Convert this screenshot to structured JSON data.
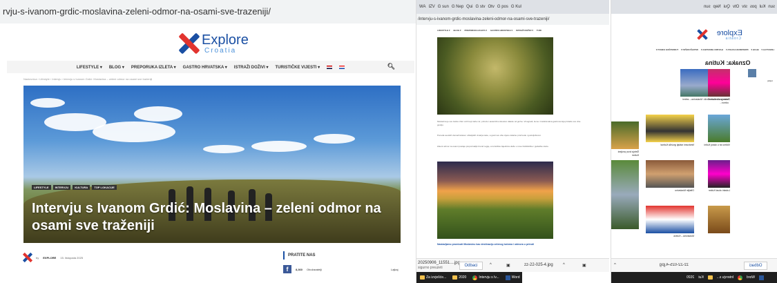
{
  "panel1": {
    "url": "rvju-s-ivanom-grdic-moslavina-zeleni-odmor-na-osami-sve-trazeniji/",
    "logo": {
      "word1": "Explore",
      "word2": "Croatia"
    },
    "nav": [
      "LIFESTYLE ▾",
      "BLOG ▾",
      "PREPORUKA IZLETA ▾",
      "GASTRO HRVATSKA ▾",
      "ISTRAŽI DOŽIVI ▾",
      "TURISTIČKE VIJESTI ▾"
    ],
    "breadcrumb": "Naslovnica › Lifestyle › Intervju › Intervju s Ivanom Grdić: Moslavina – zeleni odmor na osami sve traženiji",
    "tags": [
      "LIFESTYLE",
      "INTERVJU",
      "KULTURA",
      "TOP LOKACIJE"
    ],
    "title": "Intervju s Ivanom Grdić: Moslavina – zeleni odmor na osami sve traženiji",
    "author_by": "by",
    "author": "EXPLORE",
    "date": "15. listopada 2025",
    "follow": "PRATITE NAS",
    "fb_count": "8,360",
    "fb_label": "Obožavatelji",
    "likes": "Lajkaj"
  },
  "panel2": {
    "tabs": [
      "WA",
      "IZV",
      "G sun",
      "G Nep",
      "Qui",
      "G stv",
      "Otv",
      "G pos",
      "G Kul"
    ],
    "url": "/intervju-s-ivanom-grdic-moslavina-zeleni-odmor-na-osami-sve-trazeniji/",
    "nav": [
      "LIFESTYLE ▾",
      "BLOG ▾",
      "PREPORUKA IZLETA ▾",
      "GASTRO HRVATSKA ▾",
      "ISTRAŽI DOŽIVI ▾",
      "TURI"
    ],
    "para1": "Moslavina je sve češće izbor onih koji traže mir, prirodu i autentično iskustvo daleko od gužve. Vinogradi, šume i tradicionalna gastronomija privlače sve više gostiju.",
    "para2": "Ponuda seoskih domaćinstava i obiteljskih vinarija raste, a gosti sve više cijene lokalne proizvode i gostoljubivost.",
    "para3": "Zeleni odmor na osami postaje prepoznatljiv brend regije, a turistička zajednica ulaže u nove biciklističke i pješačke staze.",
    "caption": "Nastavljamo promicati Moslavinu kao destinaciju zelenog turizma i odmora u prirodi",
    "download_file": "20250906_11551....jpg",
    "download_status": "sigurno preuzeti",
    "dismiss": "Odbaci",
    "file2": "zz-22-025-4.jpg",
    "taskbar": [
      "Za izvješće...",
      "2020",
      "Intervju s Iv...",
      "Word"
    ]
  },
  "panel3": {
    "tabs": [
      "sun",
      "Kul",
      "pos",
      "stv",
      "Otv",
      "Qui",
      "Nep",
      "sun"
    ],
    "logo": {
      "word1": "Explore",
      "word2": "Croatia"
    },
    "nav": [
      "LIFESTYLE ▾",
      "BLOG ▾",
      "PREPORUKA IZLETA ▾",
      "GASTRO HRVATSKA ▾",
      "ISTRAŽI DOŽIVI ▾",
      "TURISTIČKE VIJESTI ▾"
    ],
    "heading": "Oznaka: Kutina",
    "side_label": "Lajkaj",
    "items": [
      {
        "title": "Žmare protiv Kutine!"
      },
      {
        "title": "Intervju s Ivanom Grdić: Moslavina – zeleni odmor..."
      },
      {
        "title": "Nestvarni raštaji grožđa Kutina!"
      },
      {
        "title": "Vidimo se u staroj Kutini"
      },
      {
        "title": "Šetnja kroz povijest Kutine"
      },
      {
        "title": "Otkrijte Moslavinu"
      },
      {
        "title": "Lokalni okusi Kutine"
      },
      {
        "title": "Moslavina – Kutina"
      }
    ],
    "dismiss": "Odbaci",
    "file": "zz-22-025-4.jpg",
    "taskbar": [
      "Word",
      "Intervju s...",
      "Kut",
      "2020"
    ]
  }
}
